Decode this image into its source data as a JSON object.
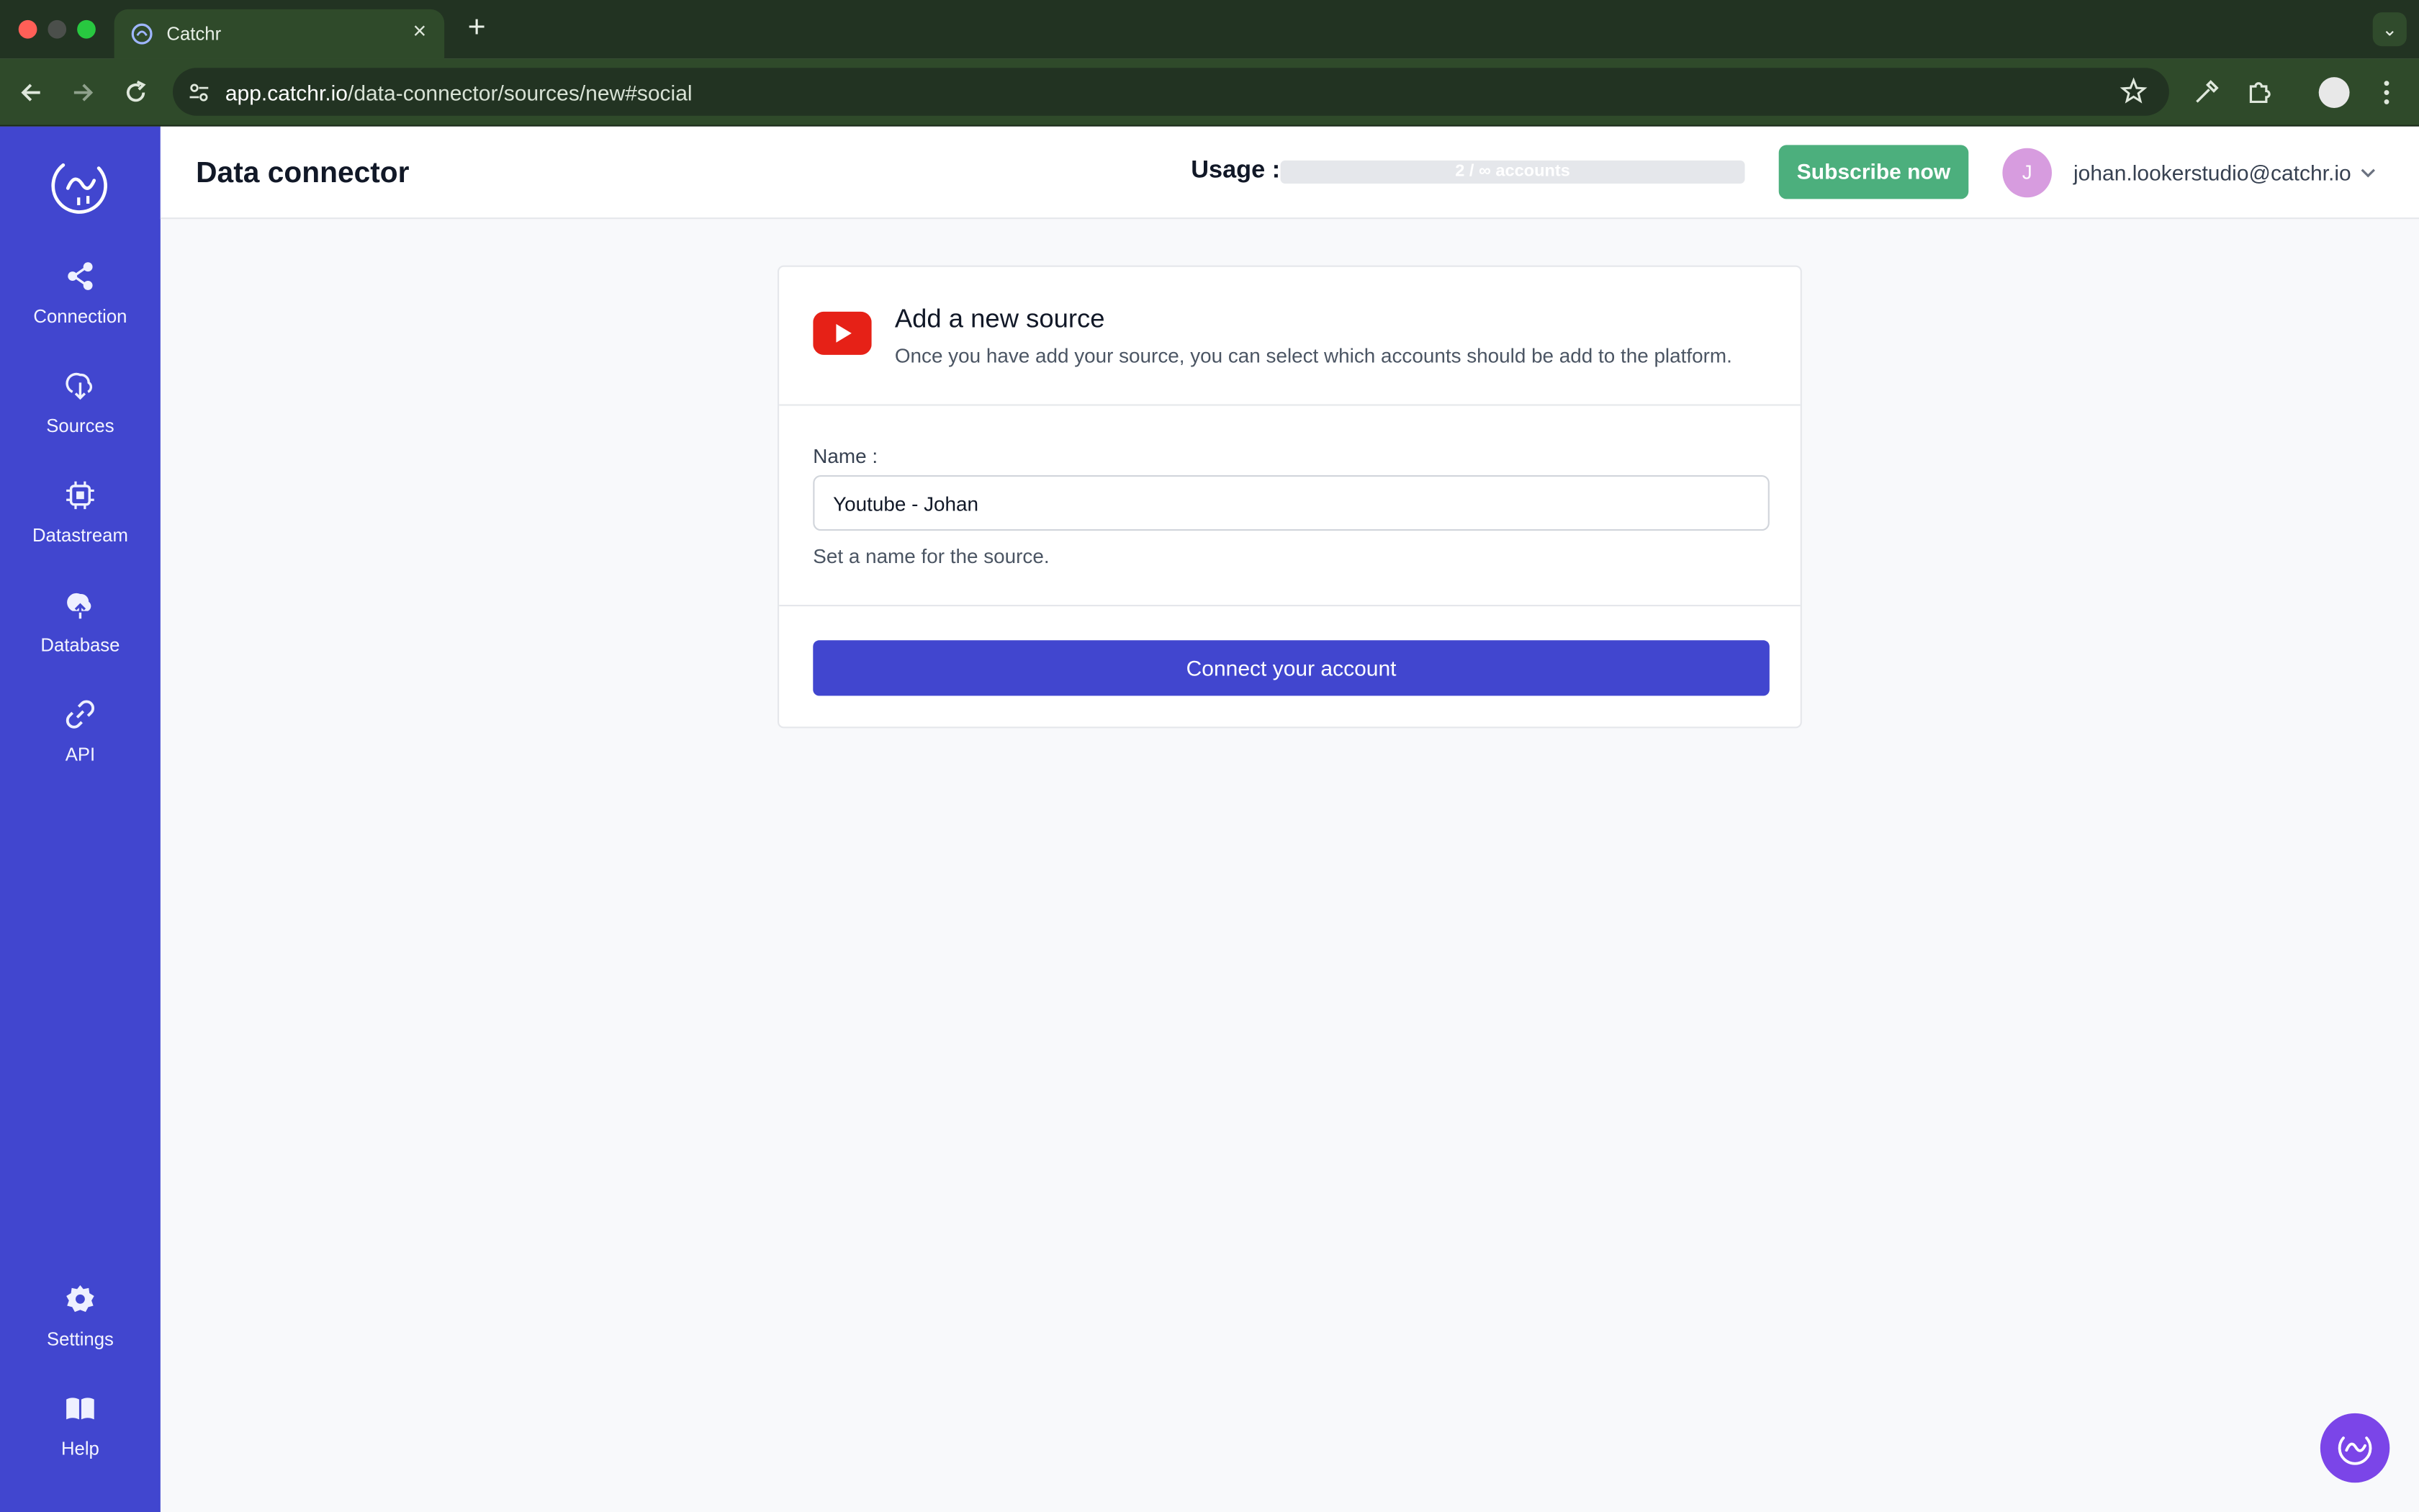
{
  "browser": {
    "tab_title": "Catchr",
    "url_host": "app.catchr.io",
    "url_path": "/data-connector/sources/new#social"
  },
  "sidebar": {
    "items": [
      {
        "label": "Connection",
        "icon": "share-icon"
      },
      {
        "label": "Sources",
        "icon": "cloud-download-icon"
      },
      {
        "label": "Datastream",
        "icon": "chip-icon"
      },
      {
        "label": "Database",
        "icon": "cloud-upload-icon"
      },
      {
        "label": "API",
        "icon": "link-icon"
      }
    ],
    "bottom_items": [
      {
        "label": "Settings",
        "icon": "gear-icon"
      },
      {
        "label": "Help",
        "icon": "book-icon"
      }
    ]
  },
  "header": {
    "title": "Data connector",
    "usage_label": "Usage :",
    "usage_text": "2 / ∞ accounts",
    "subscribe_label": "Subscribe now",
    "avatar_initial": "J",
    "user_email": "johan.lookerstudio@catchr.io"
  },
  "card": {
    "title": "Add a new source",
    "subtitle": "Once you have add your source, you can select which accounts should be add to the platform.",
    "name_label": "Name :",
    "name_value": "Youtube - Johan",
    "name_help": "Set a name for the source.",
    "connect_label": "Connect your account"
  },
  "colors": {
    "sidebar": "#4146cf",
    "subscribe": "#4caf7d",
    "chat": "#7b45e8",
    "youtube": "#e62117"
  }
}
